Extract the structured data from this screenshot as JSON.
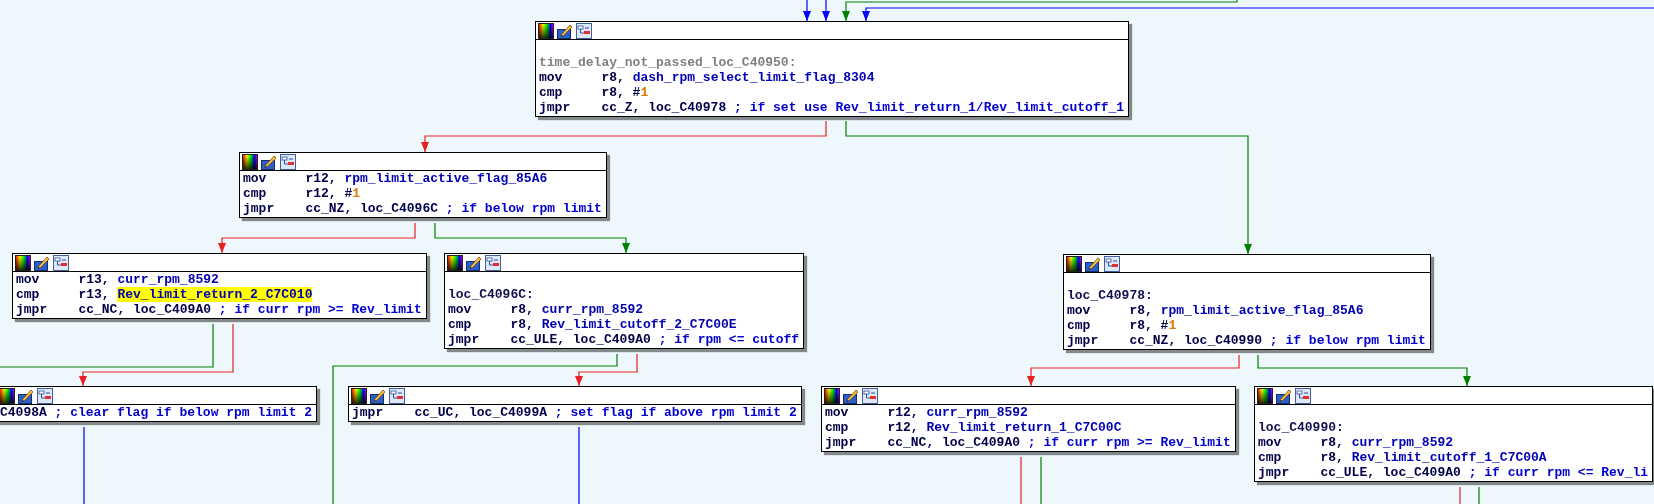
{
  "nodes": [
    {
      "lines": [
        {
          "kind": "label",
          "dim": true,
          "text": "time_delay_not_passed_loc_C40950:"
        },
        {
          "kind": "code",
          "mnemonic": "mov",
          "segments": [
            {
              "kind": "plain",
              "t": "r8, "
            },
            {
              "kind": "name",
              "t": "dash_rpm_select_limit_flag_8304"
            }
          ]
        },
        {
          "kind": "code",
          "mnemonic": "cmp",
          "segments": [
            {
              "kind": "plain",
              "t": "r8, #"
            },
            {
              "kind": "num",
              "t": "1"
            }
          ]
        },
        {
          "kind": "code",
          "mnemonic": "jmpr",
          "segments": [
            {
              "kind": "plain",
              "t": "cc_Z, loc_C40978 "
            },
            {
              "kind": "comment",
              "t": "; if set use Rev_limit_return_1/Rev_limit_cutoff_1"
            }
          ]
        }
      ]
    },
    {
      "lines": [
        {
          "kind": "code",
          "mnemonic": "mov",
          "segments": [
            {
              "kind": "plain",
              "t": "r12, "
            },
            {
              "kind": "name",
              "t": "rpm_limit_active_flag_85A6"
            }
          ]
        },
        {
          "kind": "code",
          "mnemonic": "cmp",
          "segments": [
            {
              "kind": "plain",
              "t": "r12, #"
            },
            {
              "kind": "num",
              "t": "1"
            }
          ]
        },
        {
          "kind": "code",
          "mnemonic": "jmpr",
          "segments": [
            {
              "kind": "plain",
              "t": "cc_NZ, loc_C4096C "
            },
            {
              "kind": "comment",
              "t": "; if below rpm limit"
            }
          ]
        }
      ]
    },
    {
      "lines": [
        {
          "kind": "code",
          "mnemonic": "mov",
          "segments": [
            {
              "kind": "plain",
              "t": "r13, "
            },
            {
              "kind": "name",
              "t": "curr_rpm_8592"
            }
          ]
        },
        {
          "kind": "code",
          "mnemonic": "cmp",
          "segments": [
            {
              "kind": "plain",
              "t": "r13, "
            },
            {
              "kind": "name",
              "t": "Rev_limit_return_2_C7C010",
              "highlighted": true
            }
          ]
        },
        {
          "kind": "code",
          "mnemonic": "jmpr",
          "segments": [
            {
              "kind": "plain",
              "t": "cc_NC, loc_C409A0 "
            },
            {
              "kind": "comment",
              "t": "; if curr rpm >= Rev_limit"
            }
          ]
        }
      ]
    },
    {
      "lines": [
        {
          "kind": "label",
          "dim": false,
          "text": "loc_C4096C:"
        },
        {
          "kind": "code",
          "mnemonic": "mov",
          "segments": [
            {
              "kind": "plain",
              "t": "r8, "
            },
            {
              "kind": "name",
              "t": "curr_rpm_8592"
            }
          ]
        },
        {
          "kind": "code",
          "mnemonic": "cmp",
          "segments": [
            {
              "kind": "plain",
              "t": "r8, "
            },
            {
              "kind": "name",
              "t": "Rev_limit_cutoff_2_C7C00E"
            }
          ]
        },
        {
          "kind": "code",
          "mnemonic": "jmpr",
          "segments": [
            {
              "kind": "plain",
              "t": "cc_ULE, loc_C409A0 "
            },
            {
              "kind": "comment",
              "t": "; if rpm <= cutoff"
            }
          ]
        }
      ]
    },
    {
      "lines": [
        {
          "kind": "fragment",
          "segments": [
            {
              "kind": "plain",
              "t": "C4098A "
            },
            {
              "kind": "comment",
              "t": "; clear flag if below rpm limit 2"
            }
          ]
        }
      ]
    },
    {
      "lines": [
        {
          "kind": "code",
          "mnemonic": "jmpr",
          "segments": [
            {
              "kind": "plain",
              "t": "cc_UC, loc_C4099A "
            },
            {
              "kind": "comment",
              "t": "; set flag if above rpm limit 2"
            }
          ]
        }
      ]
    },
    {
      "lines": [
        {
          "kind": "code",
          "mnemonic": "mov",
          "segments": [
            {
              "kind": "plain",
              "t": "r12, "
            },
            {
              "kind": "name",
              "t": "curr_rpm_8592"
            }
          ]
        },
        {
          "kind": "code",
          "mnemonic": "cmp",
          "segments": [
            {
              "kind": "plain",
              "t": "r12, "
            },
            {
              "kind": "name",
              "t": "Rev_limit_return_1_C7C00C"
            }
          ]
        },
        {
          "kind": "code",
          "mnemonic": "jmpr",
          "segments": [
            {
              "kind": "plain",
              "t": "cc_NC, loc_C409A0 "
            },
            {
              "kind": "comment",
              "t": "; if curr rpm >= Rev_limit"
            }
          ]
        }
      ]
    },
    {
      "lines": [
        {
          "kind": "label",
          "dim": false,
          "text": "loc_C40978:"
        },
        {
          "kind": "code",
          "mnemonic": "mov",
          "segments": [
            {
              "kind": "plain",
              "t": "r8, "
            },
            {
              "kind": "name",
              "t": "rpm_limit_active_flag_85A6"
            }
          ]
        },
        {
          "kind": "code",
          "mnemonic": "cmp",
          "segments": [
            {
              "kind": "plain",
              "t": "r8, #"
            },
            {
              "kind": "num",
              "t": "1"
            }
          ]
        },
        {
          "kind": "code",
          "mnemonic": "jmpr",
          "segments": [
            {
              "kind": "plain",
              "t": "cc_NZ, loc_C40990 "
            },
            {
              "kind": "comment",
              "t": "; if below rpm limit"
            }
          ]
        }
      ]
    },
    {
      "lines": [
        {
          "kind": "label",
          "dim": false,
          "text": "loc_C40990:"
        },
        {
          "kind": "code",
          "mnemonic": "mov",
          "segments": [
            {
              "kind": "plain",
              "t": "r8, "
            },
            {
              "kind": "name",
              "t": "curr_rpm_8592"
            }
          ]
        },
        {
          "kind": "code",
          "mnemonic": "cmp",
          "segments": [
            {
              "kind": "plain",
              "t": "r8, "
            },
            {
              "kind": "name",
              "t": "Rev_limit_cutoff_1_C7C00A"
            }
          ]
        },
        {
          "kind": "code",
          "mnemonic": "jmpr",
          "segments": [
            {
              "kind": "plain",
              "t": "cc_ULE, loc_C409A0 "
            },
            {
              "kind": "comment",
              "t": "; if curr rpm <= Rev_li"
            }
          ]
        }
      ]
    }
  ],
  "edges": [
    {
      "kind": "unconditional"
    },
    {
      "kind": "unconditional"
    },
    {
      "kind": "true"
    },
    {
      "kind": "unconditional"
    },
    {
      "kind": "false"
    },
    {
      "kind": "true"
    },
    {
      "kind": "false"
    },
    {
      "kind": "true"
    },
    {
      "kind": "true"
    },
    {
      "kind": "false"
    },
    {
      "kind": "false"
    },
    {
      "kind": "true"
    },
    {
      "kind": "unconditional"
    },
    {
      "kind": "unconditional"
    },
    {
      "kind": "false"
    },
    {
      "kind": "true"
    },
    {
      "kind": "false"
    },
    {
      "kind": "true"
    },
    {
      "kind": "false"
    },
    {
      "kind": "true"
    }
  ]
}
